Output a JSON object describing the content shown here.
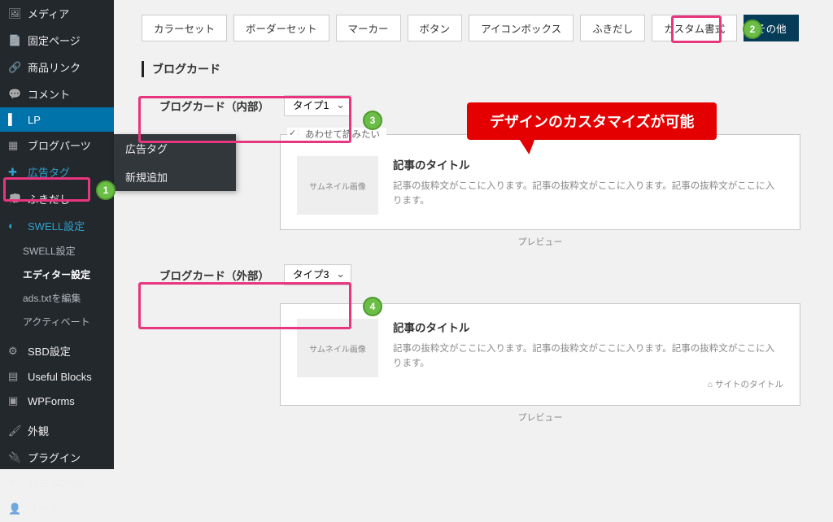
{
  "sidebar": {
    "items": [
      {
        "label": "メディア",
        "icon": "media"
      },
      {
        "label": "固定ページ",
        "icon": "page"
      },
      {
        "label": "商品リンク",
        "icon": "link"
      },
      {
        "label": "コメント",
        "icon": "comment"
      },
      {
        "label": "LP",
        "icon": "lp",
        "active": true
      },
      {
        "label": "ブログパーツ",
        "icon": "parts"
      },
      {
        "label": "広告タグ",
        "icon": "ad",
        "hl": true
      },
      {
        "label": "ふきだし",
        "icon": "balloon"
      },
      {
        "label": "SWELL設定",
        "icon": "swell",
        "boxed": true
      }
    ],
    "subs": [
      {
        "label": "SWELL設定"
      },
      {
        "label": "エディター設定",
        "bold": true
      },
      {
        "label": "ads.txtを編集"
      },
      {
        "label": "アクティベート"
      }
    ],
    "items2": [
      {
        "label": "SBD設定",
        "icon": "sbd"
      },
      {
        "label": "Useful Blocks",
        "icon": "ub"
      },
      {
        "label": "WPForms",
        "icon": "wpf"
      }
    ],
    "items3": [
      {
        "label": "外観",
        "icon": "brush"
      },
      {
        "label": "プラグイン",
        "icon": "plug"
      },
      {
        "label": "THE SONIC",
        "icon": "sonic"
      },
      {
        "label": "ユーザー",
        "icon": "user"
      }
    ]
  },
  "flyout": [
    "広告タグ",
    "新規追加"
  ],
  "tabs": [
    "カラーセット",
    "ボーダーセット",
    "マーカー",
    "ボタン",
    "アイコンボックス",
    "ふきだし",
    "カスタム書式",
    "その他"
  ],
  "active_tab": 7,
  "section": "ブログカード",
  "rows": [
    {
      "label": "ブログカード（内部）",
      "value": "タイプ1",
      "preview": {
        "legend": "あわせて読みたい",
        "thumb": "サムネイル画像",
        "title": "記事のタイトル",
        "desc": "記事の抜粋文がここに入ります。記事の抜粋文がここに入ります。記事の抜粋文がここに入ります。",
        "plabel": "プレビュー"
      }
    },
    {
      "label": "ブログカード（外部）",
      "value": "タイプ3",
      "preview": {
        "thumb": "サムネイル画像",
        "title": "記事のタイトル",
        "desc": "記事の抜粋文がここに入ります。記事の抜粋文がここに入ります。記事の抜粋文がここに入ります。",
        "site": "サイトのタイトル",
        "plabel": "プレビュー"
      }
    }
  ],
  "callout": "デザインのカスタマイズが可能",
  "badges": [
    "1",
    "2",
    "3",
    "4"
  ]
}
